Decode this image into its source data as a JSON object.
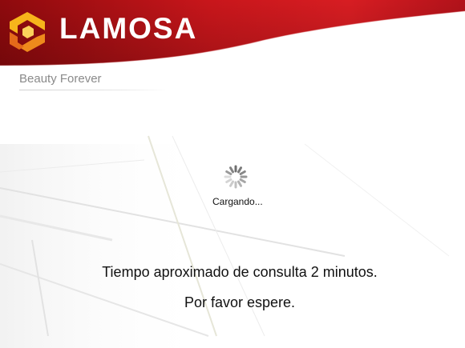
{
  "header": {
    "brand": "LAMOSA",
    "tagline": "Beauty Forever",
    "logo_icon": "lamosa-logo-icon",
    "colors": {
      "red_dark": "#9a0a0e",
      "red": "#d21a1f",
      "logo_yellow": "#f5b21a",
      "logo_orange": "#e8641a"
    }
  },
  "loading": {
    "spinner_icon": "spinner-icon",
    "label": "Cargando..."
  },
  "messages": {
    "line1": "Tiempo aproximado de consulta 2 minutos.",
    "line2": "Por favor espere."
  }
}
